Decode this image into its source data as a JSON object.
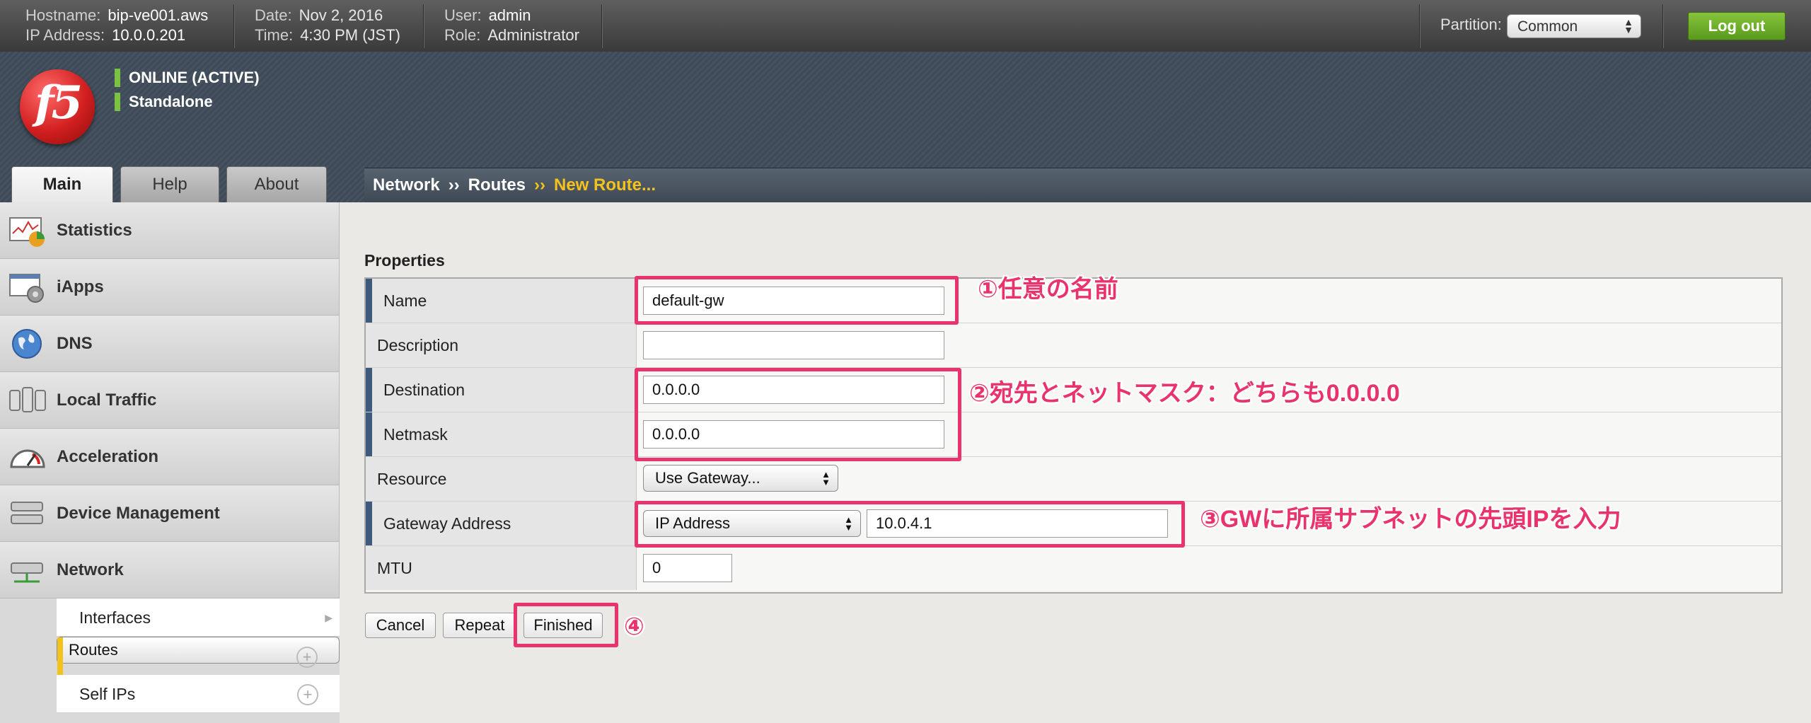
{
  "header": {
    "hostname_label": "Hostname:",
    "hostname": "bip-ve001.aws",
    "ip_label": "IP Address:",
    "ip": "10.0.0.201",
    "date_label": "Date:",
    "date": "Nov 2, 2016",
    "time_label": "Time:",
    "time": "4:30 PM (JST)",
    "user_label": "User:",
    "user": "admin",
    "role_label": "Role:",
    "role": "Administrator",
    "partition_label": "Partition:",
    "partition_value": "Common",
    "logout_label": "Log out"
  },
  "banner": {
    "logo_text": "f5",
    "status_1": "ONLINE (ACTIVE)",
    "status_2": "Standalone"
  },
  "tabs": [
    {
      "label": "Main",
      "active": true
    },
    {
      "label": "Help",
      "active": false
    },
    {
      "label": "About",
      "active": false
    }
  ],
  "breadcrumb": {
    "items": [
      "Network",
      "Routes"
    ],
    "separator": "››",
    "current": "New Route..."
  },
  "sidebar": {
    "items": [
      {
        "label": "Statistics",
        "icon": "statistics-icon"
      },
      {
        "label": "iApps",
        "icon": "iapps-icon"
      },
      {
        "label": "DNS",
        "icon": "globe-icon"
      },
      {
        "label": "Local Traffic",
        "icon": "local-traffic-icon"
      },
      {
        "label": "Acceleration",
        "icon": "gauge-icon"
      },
      {
        "label": "Device Management",
        "icon": "device-icon"
      },
      {
        "label": "Network",
        "icon": "network-icon"
      }
    ],
    "subitems": [
      {
        "label": "Interfaces",
        "selected": false,
        "has_plus": false
      },
      {
        "label": "Routes",
        "selected": true,
        "has_plus": true
      },
      {
        "label": "Self IPs",
        "selected": false,
        "has_plus": true
      }
    ]
  },
  "form": {
    "section_title": "Properties",
    "name_label": "Name",
    "name_value": "default-gw",
    "description_label": "Description",
    "description_value": "",
    "destination_label": "Destination",
    "destination_value": "0.0.0.0",
    "netmask_label": "Netmask",
    "netmask_value": "0.0.0.0",
    "resource_label": "Resource",
    "resource_value": "Use Gateway...",
    "gateway_label": "Gateway Address",
    "gateway_type": "IP Address",
    "gateway_value": "10.0.4.1",
    "mtu_label": "MTU",
    "mtu_value": "0"
  },
  "buttons": {
    "cancel": "Cancel",
    "repeat": "Repeat",
    "finished": "Finished"
  },
  "annotations": {
    "note_1": "①任意の名前",
    "note_2": "②宛先とネットマスク：どちらも0.0.0.0",
    "note_3": "③GWに所属サブネットの先頭IPを入力",
    "note_4": "④"
  },
  "colors": {
    "annotation": "#e8336c",
    "accent_yellow": "#f3c21d",
    "status_green": "#7cc242",
    "logout_green": "#6aaa2a",
    "required_bar": "#3d5a7e"
  }
}
